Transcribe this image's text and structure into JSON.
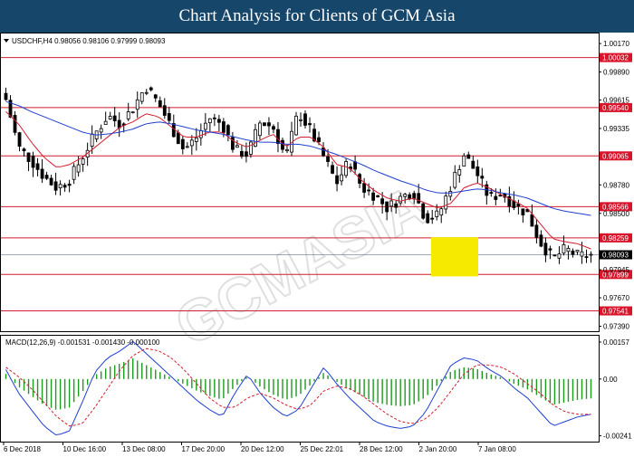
{
  "banner": {
    "title": "Chart Analysis for Clients of GCM Asia"
  },
  "colors": {
    "banner_bg": "#17466b",
    "bull_candle": "#ffffff",
    "bear_candle": "#000000",
    "ma_fast": "#d11f2f",
    "ma_slow": "#1f3fd1",
    "level_line": "#d11f2f",
    "level_label_bg": "#d8132a",
    "price_label_bg": "#000000",
    "highlight_box": "#f5ea00",
    "macd_hist": "#1e9a1e",
    "macd_line": "#1f3fd1",
    "macd_signal": "#d11f2f"
  },
  "chart_data": [
    {
      "type": "candlestick",
      "symbol_line": "USDCHF,H4  0.98056 0.98106 0.97999 0.98093",
      "ylim": [
        0.9735,
        1.0026
      ],
      "y_ticks": [
        "1.00170",
        "0.99890",
        "0.99615",
        "0.99335",
        "0.98780",
        "0.98500",
        "0.97945",
        "0.97670",
        "0.97390"
      ],
      "x_ticks": [
        "6 Dec 2018",
        "10 Dec 16:00",
        "13 Dec 08:00",
        "17 Dec 20:00",
        "20 Dec 12:00",
        "25 Dec 22:01",
        "28 Dec 12:00",
        "2 Jan 20:00",
        "7 Jan 08:00"
      ],
      "current_price": "0.98093",
      "levels": [
        "1.00032",
        "0.99540",
        "0.99065",
        "0.98566",
        "0.98259",
        "0.97899",
        "0.97541"
      ],
      "highlight_box": {
        "low": 0.9788,
        "high": 0.98265
      },
      "close_anchors": [
        0.9962,
        0.9915,
        0.9902,
        0.9886,
        0.9875,
        0.9883,
        0.9905,
        0.9928,
        0.9946,
        0.9938,
        0.9954,
        0.9975,
        0.9958,
        0.9935,
        0.9912,
        0.9925,
        0.9944,
        0.9938,
        0.9912,
        0.9908,
        0.994,
        0.9935,
        0.9905,
        0.995,
        0.993,
        0.9905,
        0.988,
        0.9902,
        0.9875,
        0.9868,
        0.9855,
        0.9865,
        0.9872,
        0.9845,
        0.9848,
        0.9878,
        0.9908,
        0.989,
        0.9865,
        0.987,
        0.9858,
        0.985,
        0.9822,
        0.9805,
        0.9815,
        0.9808,
        0.9809
      ],
      "ma_fast_anchors": [
        0.995,
        0.9938,
        0.992,
        0.9905,
        0.9895,
        0.9898,
        0.9905,
        0.9915,
        0.9925,
        0.9935,
        0.994,
        0.9948,
        0.9945,
        0.9935,
        0.9925,
        0.9925,
        0.993,
        0.993,
        0.992,
        0.9915,
        0.9922,
        0.9928,
        0.9915,
        0.9925,
        0.9925,
        0.9915,
        0.9898,
        0.9895,
        0.9882,
        0.9872,
        0.9865,
        0.9862,
        0.9865,
        0.986,
        0.9855,
        0.986,
        0.9875,
        0.988,
        0.9875,
        0.9868,
        0.9862,
        0.9855,
        0.984,
        0.9825,
        0.9822,
        0.982,
        0.9815
      ],
      "ma_slow_anchors": [
        0.996,
        0.9956,
        0.995,
        0.9945,
        0.994,
        0.9935,
        0.993,
        0.9927,
        0.9928,
        0.993,
        0.9933,
        0.9938,
        0.994,
        0.9938,
        0.9935,
        0.9932,
        0.993,
        0.9928,
        0.9925,
        0.9922,
        0.992,
        0.992,
        0.9918,
        0.9918,
        0.9916,
        0.9912,
        0.9908,
        0.9903,
        0.9898,
        0.9892,
        0.9887,
        0.9882,
        0.9878,
        0.9873,
        0.987,
        0.987,
        0.9872,
        0.9874,
        0.9873,
        0.987,
        0.9868,
        0.9865,
        0.986,
        0.9855,
        0.9852,
        0.985,
        0.9848
      ]
    },
    {
      "type": "macd",
      "label": "MACD(12,26,9) -0.001531 -0.001430 -0.000100",
      "ylim": [
        -0.00262,
        0.0018
      ],
      "y_ticks": [
        "0.00157",
        "0.00",
        "-0.00241"
      ],
      "macd_anchors": [
        0.0004,
        -0.0006,
        -0.0013,
        -0.002,
        -0.0024,
        -0.0022,
        -0.001,
        0.0003,
        0.0009,
        0.0012,
        0.0016,
        0.0011,
        0.0006,
        0.0001,
        -0.0004,
        -0.0009,
        -0.0013,
        -0.0016,
        -0.0006,
        0.0002,
        -0.0006,
        -0.0012,
        -0.0016,
        -0.0013,
        -0.0004,
        0.0005,
        -0.0002,
        -0.0008,
        -0.0013,
        -0.0018,
        -0.002,
        -0.0021,
        -0.002,
        -0.0014,
        -0.0004,
        0.0006,
        0.0009,
        0.0008,
        0.0004,
        0.0001,
        -0.0004,
        -0.0008,
        -0.0014,
        -0.002,
        -0.0018,
        -0.0016,
        -0.0015
      ],
      "signal_anchors": [
        0.0005,
        0.0001,
        -0.0004,
        -0.001,
        -0.0016,
        -0.002,
        -0.0019,
        -0.0012,
        -0.0004,
        0.0004,
        0.001,
        0.0013,
        0.0012,
        0.0009,
        0.0004,
        -0.0002,
        -0.0008,
        -0.0012,
        -0.0012,
        -0.0008,
        -0.0006,
        -0.0008,
        -0.0011,
        -0.0013,
        -0.0011,
        -0.0005,
        -0.0003,
        -0.0004,
        -0.0007,
        -0.0011,
        -0.0015,
        -0.0018,
        -0.0019,
        -0.0017,
        -0.0012,
        -0.0005,
        0.0002,
        0.0006,
        0.0006,
        0.0005,
        0.0002,
        -0.0002,
        -0.0006,
        -0.0011,
        -0.0014,
        -0.0015,
        -0.0015
      ]
    }
  ]
}
